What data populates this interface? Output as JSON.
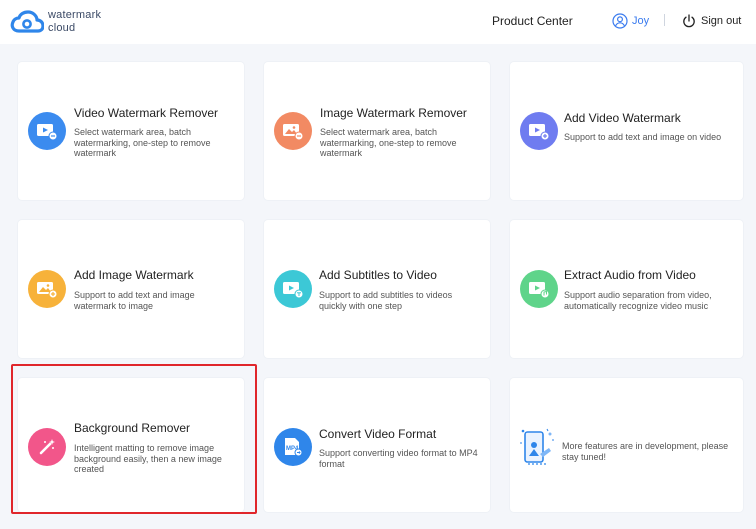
{
  "header": {
    "logo_line1": "watermark",
    "logo_line2": "cloud",
    "product_center": "Product Center",
    "username": "Joy",
    "signout": "Sign out"
  },
  "cards": [
    {
      "title": "Video Watermark Remover",
      "desc": "Select watermark area, batch watermarking, one-step to remove watermark",
      "color": "#3b8bef",
      "icon": "video-icon"
    },
    {
      "title": "Image Watermark Remover",
      "desc": "Select watermark area, batch watermarking, one-step to remove watermark",
      "color": "#f28a63",
      "icon": "image-icon"
    },
    {
      "title": "Add Video Watermark",
      "desc": "Support to add text and image on video",
      "color": "#6f7cf0",
      "icon": "video-icon"
    },
    {
      "title": "Add Image Watermark",
      "desc": "Support to add text and image watermark to image",
      "color": "#f7b23a",
      "icon": "image-icon"
    },
    {
      "title": "Add Subtitles to Video",
      "desc": "Support to add subtitles to videos quickly with one step",
      "color": "#3cc8d6",
      "icon": "subtitle-video-icon"
    },
    {
      "title": "Extract Audio from Video",
      "desc": "Support audio separation from video, automatically recognize video music",
      "color": "#5fd48a",
      "icon": "audio-video-icon"
    },
    {
      "title": "Background Remover",
      "desc": "Intelligent matting to remove image background easily,  then a new image created",
      "color": "#f2568a",
      "icon": "magic-wand-icon"
    },
    {
      "title": "Convert Video Format",
      "desc": "Support converting video format to MP4 format",
      "color": "#2f86ea",
      "icon": "mp4-file-icon"
    }
  ],
  "placeholder": {
    "desc": "More features are in development, please stay tuned!",
    "icon": "development-illustration-icon"
  }
}
